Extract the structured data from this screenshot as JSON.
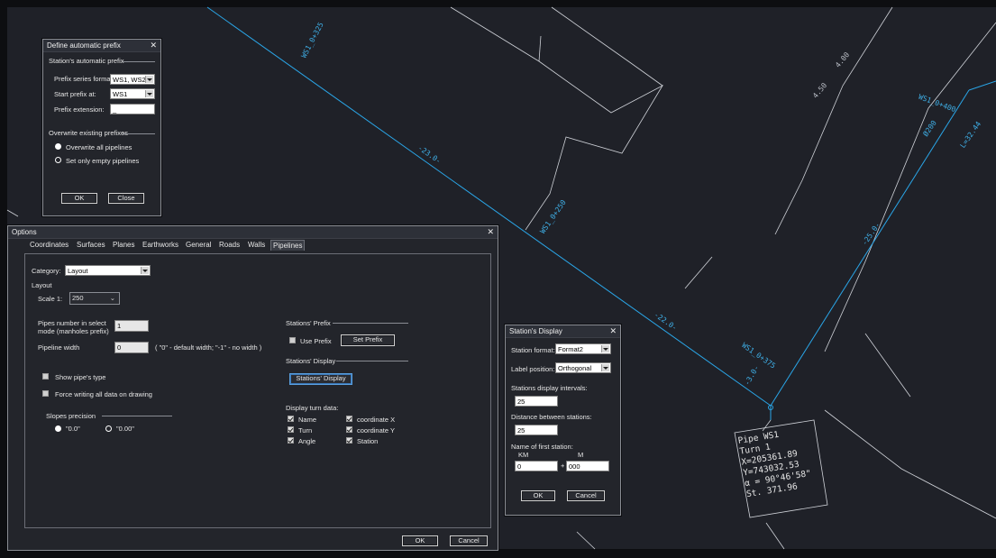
{
  "canvas": {
    "labels": {
      "ws1_325": "WS1_0+325",
      "ws1_250": "WS1_0+250",
      "ws1_400": "WS1_0+400",
      "ws1_375": "WS1_0+375",
      "c23": "-23.0-",
      "c22": "-22.0-",
      "c25": "-25.0-",
      "c30": "-3.0-",
      "d200": "Ø200",
      "l3244": "L=32.44",
      "c450": "4.50",
      "c400": "4.00"
    },
    "pipe_label": [
      "Pipe WS1",
      "Turn 1",
      "X=205361.89",
      "Y=743032.53",
      "α = 90°46'58\"",
      "St. 371.96"
    ]
  },
  "prefix_dialog": {
    "title": "Define automatic prefix",
    "section1": "Station's automatic prefix",
    "series_format_label": "Prefix series format:",
    "series_format_value": "WS1, WS2",
    "start_label": "Start prefix at:",
    "start_value": "WS1",
    "extension_label": "Prefix extension:",
    "extension_value": "_",
    "section2": "Overwrite existing prefixes",
    "opt_all": "Overwrite all pipelines",
    "opt_empty": "Set only empty pipelines",
    "ok": "OK",
    "close": "Close"
  },
  "options_dialog": {
    "title": "Options",
    "tabs": [
      "Coordinates",
      "Surfaces",
      "Planes",
      "Earthworks",
      "General",
      "Roads",
      "Walls",
      "Pipelines"
    ],
    "category_label": "Category:",
    "category_value": "Layout",
    "layout_label": "Layout",
    "scale_label": "Scale 1:",
    "scale_value": "250",
    "pipes_number_label_1": "Pipes number in select",
    "pipes_number_label_2": "mode (manholes prefix)",
    "pipes_number_value": "1",
    "pipeline_width_label": "Pipeline width",
    "pipeline_width_value": "0",
    "pipeline_width_hint": "( \"0\" - default width;  \"-1\" - no width )",
    "show_type": "Show pipe's type",
    "force_writing": "Force writing all data on drawing",
    "slopes_precision": "Slopes precision",
    "slope_opt1": "\"0.0\"",
    "slope_opt2": "\"0.00\"",
    "stations_prefix": "Stations' Prefix",
    "use_prefix": "Use Prefix",
    "set_prefix": "Set Prefix",
    "stations_display": "Stations' Display",
    "stations_display_btn": "Stations' Display",
    "display_turn_data": "Display turn data:",
    "turn_items": [
      "Name",
      "Turn",
      "Angle",
      "coordinate X",
      "coordinate Y",
      "Station"
    ],
    "ok": "OK",
    "cancel": "Cancel"
  },
  "station_dialog": {
    "title": "Station's Display",
    "format_label": "Station format:",
    "format_value": "Format2",
    "label_pos_label": "Label position:",
    "label_pos_value": "Orthogonal",
    "intervals_label": "Stations display intervals:",
    "intervals_value": "25",
    "distance_label": "Distance between stations:",
    "distance_value": "25",
    "first_station_label": "Name of first station:",
    "km_label": "KM",
    "m_label": "M",
    "km_value": "0",
    "plus": "+",
    "m_value": "000",
    "ok": "OK",
    "cancel": "Cancel"
  }
}
